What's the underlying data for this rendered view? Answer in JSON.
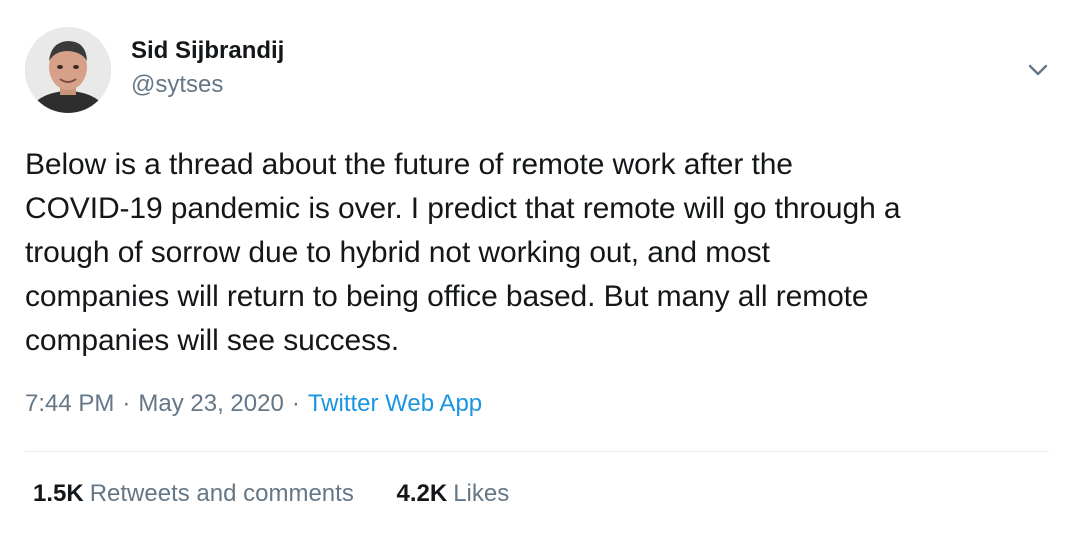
{
  "author": {
    "name": "Sid Sijbrandij",
    "handle": "@sytses",
    "avatar_icon": "user-avatar"
  },
  "menu": {
    "icon": "chevron-down-icon"
  },
  "tweet": {
    "lines": [
      "Below is a thread about the future of remote work after the",
      "COVID-19 pandemic is over. I predict that remote will go through a",
      "trough of sorrow due to hybrid not working out, and most",
      "companies will return to being office based. But many all remote",
      "companies will see success."
    ]
  },
  "meta": {
    "time": "7:44 PM",
    "separator": "·",
    "date": "May 23, 2020",
    "source": "Twitter Web App"
  },
  "stats": {
    "retweets_count": "1.5K",
    "retweets_label": "Retweets and comments",
    "likes_count": "4.2K",
    "likes_label": "Likes"
  },
  "colors": {
    "text": "#14171a",
    "secondary": "#657786",
    "link": "#1b95e0",
    "divider": "#e6ecf0"
  }
}
